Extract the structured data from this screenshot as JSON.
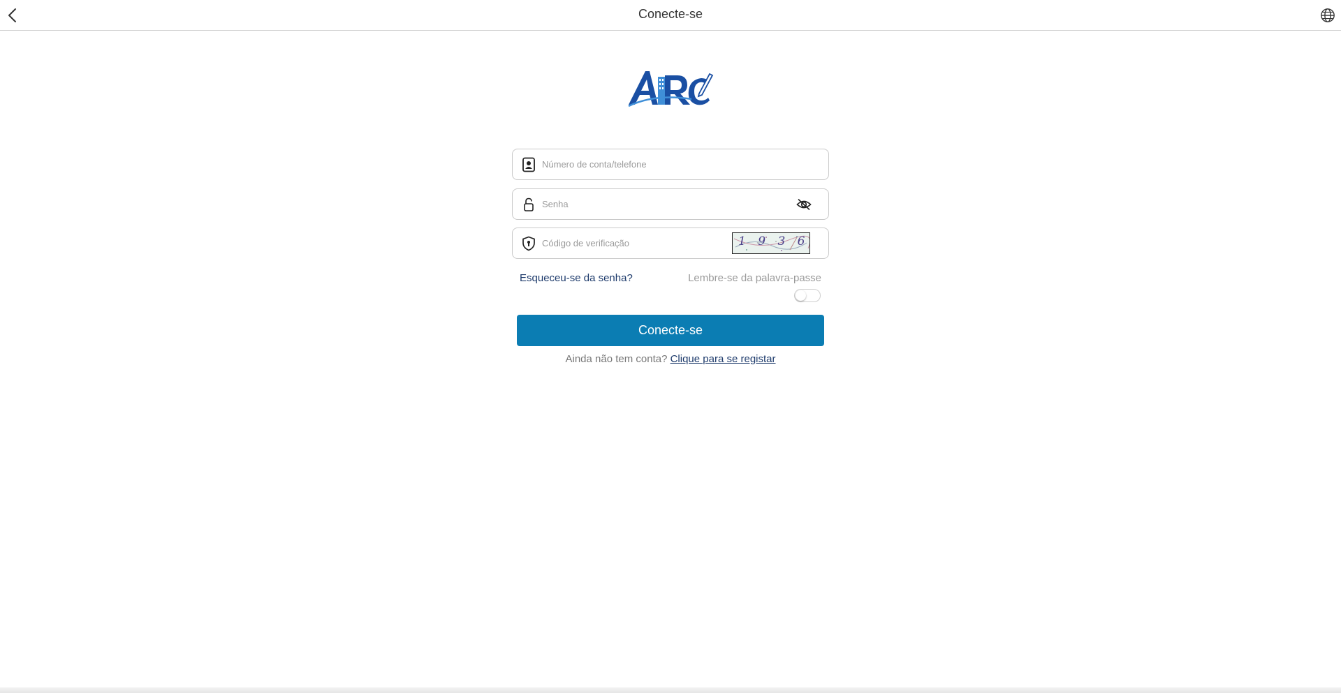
{
  "header": {
    "title": "Conecte-se",
    "back_icon": "chevron-left-icon",
    "language_icon": "globe-icon"
  },
  "logo": {
    "text": "ARC",
    "colors": [
      "#1a4fa3",
      "#3f8fd8"
    ]
  },
  "form": {
    "account_placeholder": "Número de conta/telefone",
    "password_placeholder": "Senha",
    "captcha_placeholder": "Código de verificação",
    "captcha_text": "1 9 3 6",
    "account_icon": "id-card-icon",
    "password_icon": "lock-icon",
    "captcha_icon": "shield-icon",
    "password_toggle_icon": "eye-icon",
    "forgot_label": "Esqueceu-se da senha?",
    "remember_label": "Lembre-se da palavra-passe",
    "remember_on": false,
    "login_label": "Conecte-se",
    "login_color": "#0b7db3"
  },
  "register": {
    "prompt": "Ainda não tem conta?",
    "link_label": "Clique para se registar"
  }
}
